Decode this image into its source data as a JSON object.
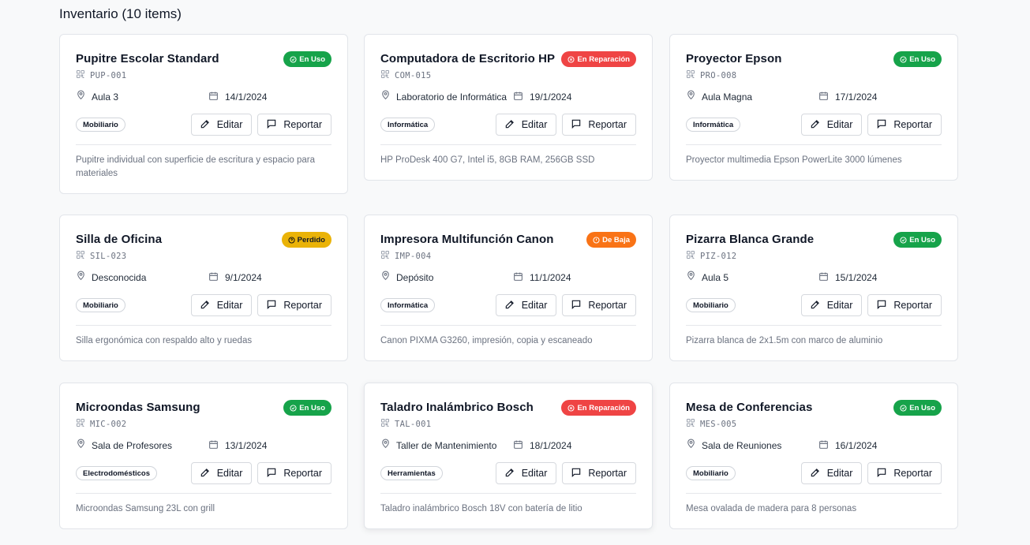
{
  "page": {
    "title": "Inventario (10 items)"
  },
  "labels": {
    "edit": "Editar",
    "report": "Reportar"
  },
  "status_colors": {
    "en_uso": "#16a34a",
    "en_reparacion": "#ef4444",
    "perdido": "#eab308",
    "de_baja": "#f97316"
  },
  "items": [
    {
      "title": "Pupitre Escolar Standard",
      "status": "En Uso",
      "code": "PUP-001",
      "location": "Aula 3",
      "date": "14/1/2024",
      "category": "Mobiliario",
      "description": "Pupitre individual con superficie de escritura y espacio para materiales"
    },
    {
      "title": "Computadora de Escritorio HP",
      "status": "En Reparación",
      "code": "COM-015",
      "location": "Laboratorio de Informática",
      "date": "19/1/2024",
      "category": "Informática",
      "description": "HP ProDesk 400 G7, Intel i5, 8GB RAM, 256GB SSD"
    },
    {
      "title": "Proyector Epson",
      "status": "En Uso",
      "code": "PRO-008",
      "location": "Aula Magna",
      "date": "17/1/2024",
      "category": "Informática",
      "description": "Proyector multimedia Epson PowerLite 3000 lúmenes"
    },
    {
      "title": "Silla de Oficina",
      "status": "Perdido",
      "code": "SIL-023",
      "location": "Desconocida",
      "date": "9/1/2024",
      "category": "Mobiliario",
      "description": "Silla ergonómica con respaldo alto y ruedas"
    },
    {
      "title": "Impresora Multifunción Canon",
      "status": "De Baja",
      "code": "IMP-004",
      "location": "Depósito",
      "date": "11/1/2024",
      "category": "Informática",
      "description": "Canon PIXMA G3260, impresión, copia y escaneado"
    },
    {
      "title": "Pizarra Blanca Grande",
      "status": "En Uso",
      "code": "PIZ-012",
      "location": "Aula 5",
      "date": "15/1/2024",
      "category": "Mobiliario",
      "description": "Pizarra blanca de 2x1.5m con marco de aluminio"
    },
    {
      "title": "Microondas Samsung",
      "status": "En Uso",
      "code": "MIC-002",
      "location": "Sala de Profesores",
      "date": "13/1/2024",
      "category": "Electrodomésticos",
      "description": "Microondas Samsung 23L con grill"
    },
    {
      "title": "Taladro Inalámbrico Bosch",
      "status": "En Reparación",
      "code": "TAL-001",
      "location": "Taller de Mantenimiento",
      "date": "18/1/2024",
      "category": "Herramientas",
      "description": "Taladro inalámbrico Bosch 18V con batería de litio"
    },
    {
      "title": "Mesa de Conferencias",
      "status": "En Uso",
      "code": "MES-005",
      "location": "Sala de Reuniones",
      "date": "16/1/2024",
      "category": "Mobiliario",
      "description": "Mesa ovalada de madera para 8 personas"
    }
  ]
}
